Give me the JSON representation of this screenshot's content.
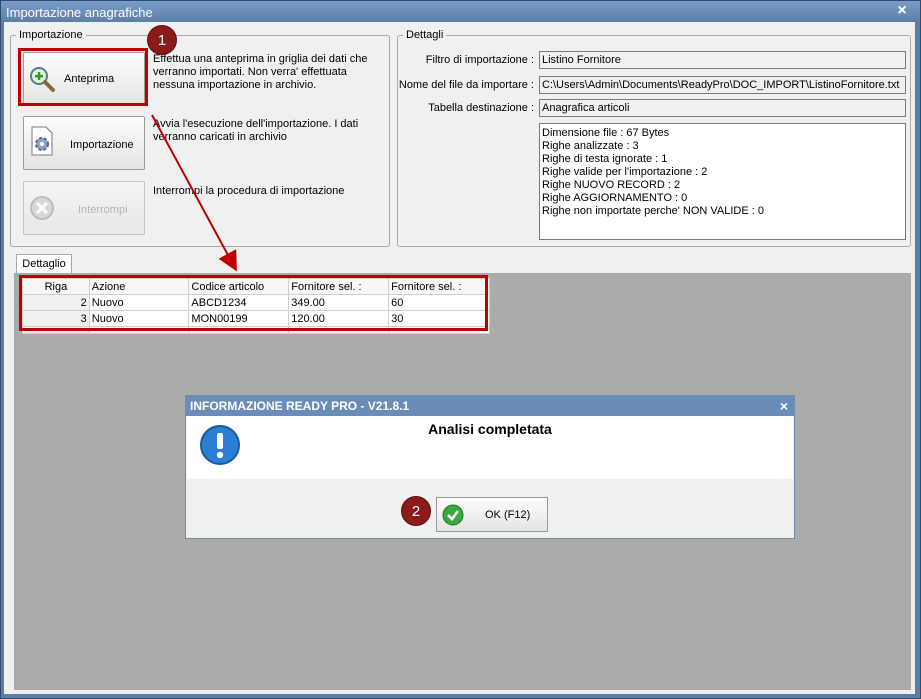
{
  "window": {
    "title": "Importazione anagrafiche"
  },
  "importazione": {
    "legend": "Importazione",
    "buttons": [
      {
        "label": "Anteprima",
        "description": "Effettua una anteprima in griglia dei dati che verranno importati. Non verra' effettuata nessuna importazione in archivio.",
        "icon": "magnifier-plus-icon"
      },
      {
        "label": "Importazione",
        "description": "Avvia l'esecuzione dell'importazione. I dati verranno caricati in archivio",
        "icon": "import-gear-icon"
      },
      {
        "label": "Interrompi",
        "description": "Interrompi la procedura di importazione",
        "icon": "stop-icon"
      }
    ]
  },
  "dettagli": {
    "legend": "Dettagli",
    "filtro_label": "Filtro di importazione :",
    "filtro_value": "Listino Fornitore",
    "file_label": "Nome del file da importare :",
    "file_value": "C:\\Users\\Admin\\Documents\\ReadyPro\\DOC_IMPORT\\ListinoFornitore.txt",
    "tabella_label": "Tabella destinazione :",
    "tabella_value": "Anagrafica articoli",
    "stats": [
      "Dimensione file : 67 Bytes",
      "Righe analizzate : 3",
      "Righe di testa ignorate : 1",
      "Righe valide per l'importazione : 2",
      "Righe NUOVO RECORD : 2",
      "Righe AGGIORNAMENTO  : 0",
      "Righe non importate perche' NON VALIDE : 0"
    ]
  },
  "tab": {
    "label": "Dettaglio"
  },
  "grid": {
    "columns": [
      "Riga",
      "Azione",
      "Codice articolo",
      "Fornitore sel. :",
      "Fornitore sel. :"
    ],
    "rows": [
      [
        "2",
        "Nuovo",
        "ABCD1234",
        "349.00",
        "60"
      ],
      [
        "3",
        "Nuovo",
        "MON00199",
        "120.00",
        "30"
      ]
    ]
  },
  "dialog": {
    "title": "INFORMAZIONE READY PRO - V21.8.1",
    "message": "Analisi completata",
    "ok_label": "OK (F12)"
  },
  "annotations": {
    "badge1": "1",
    "badge2": "2",
    "color": "#c00000"
  }
}
